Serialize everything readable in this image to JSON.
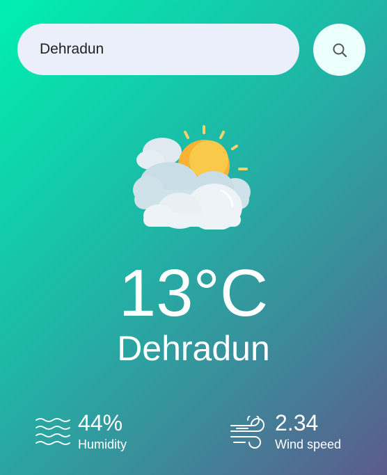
{
  "search": {
    "value": "Dehradun",
    "icon": "search-icon"
  },
  "weather": {
    "icon": "partly-cloudy-sun-icon",
    "temperature": "13°C",
    "city": "Dehradun"
  },
  "humidity": {
    "value": "44%",
    "label": "Humidity",
    "icon": "humidity-waves-icon"
  },
  "wind": {
    "value": "2.34",
    "label": "Wind speed",
    "icon": "wind-icon"
  },
  "colors": {
    "gradient_start": "#00f0b0",
    "gradient_end": "#5b5b8c",
    "sun": "#f9b233",
    "cloud": "#eef3f7"
  }
}
